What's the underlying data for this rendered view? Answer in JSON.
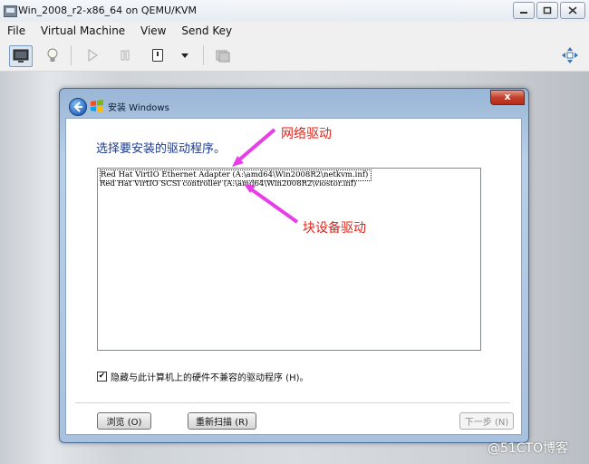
{
  "window": {
    "title": "Win_2008_r2-x86_64 on QEMU/KVM",
    "controls": [
      "minimize-icon",
      "maximize-icon",
      "close-icon"
    ]
  },
  "menu": [
    "File",
    "Virtual Machine",
    "View",
    "Send Key"
  ],
  "toolbar": {
    "buttons": [
      "console-icon",
      "lightbulb-icon",
      "play-icon",
      "pause-icon",
      "power-icon",
      "dropdown-icon",
      "screenshot-icon",
      "fullscreen-move-icon"
    ]
  },
  "dialog": {
    "title": "安装 Windows",
    "close_label": "x",
    "prompt": "选择要安装的驱动程序。",
    "drivers": [
      "Red Hat VirtIO Ethernet Adapter (A:\\amd64\\Win2008R2\\netkvm.inf)",
      "Red Hat VirtIO SCSI controller (A:\\amd64\\Win2008R2\\viostor.inf)"
    ],
    "selected_index": 0,
    "hide_incompatible": {
      "label": "隐藏与此计算机上的硬件不兼容的驱动程序 (H)。",
      "checked": true,
      "mark": "✔"
    },
    "buttons": {
      "browse": "浏览 (O)",
      "rescan": "重新扫描 (R)",
      "next": "下一步 (N)"
    }
  },
  "annotations": {
    "network_driver": "网络驱动",
    "block_driver": "块设备驱动",
    "color": "#e2231a"
  },
  "watermark": "@51CTO博客"
}
